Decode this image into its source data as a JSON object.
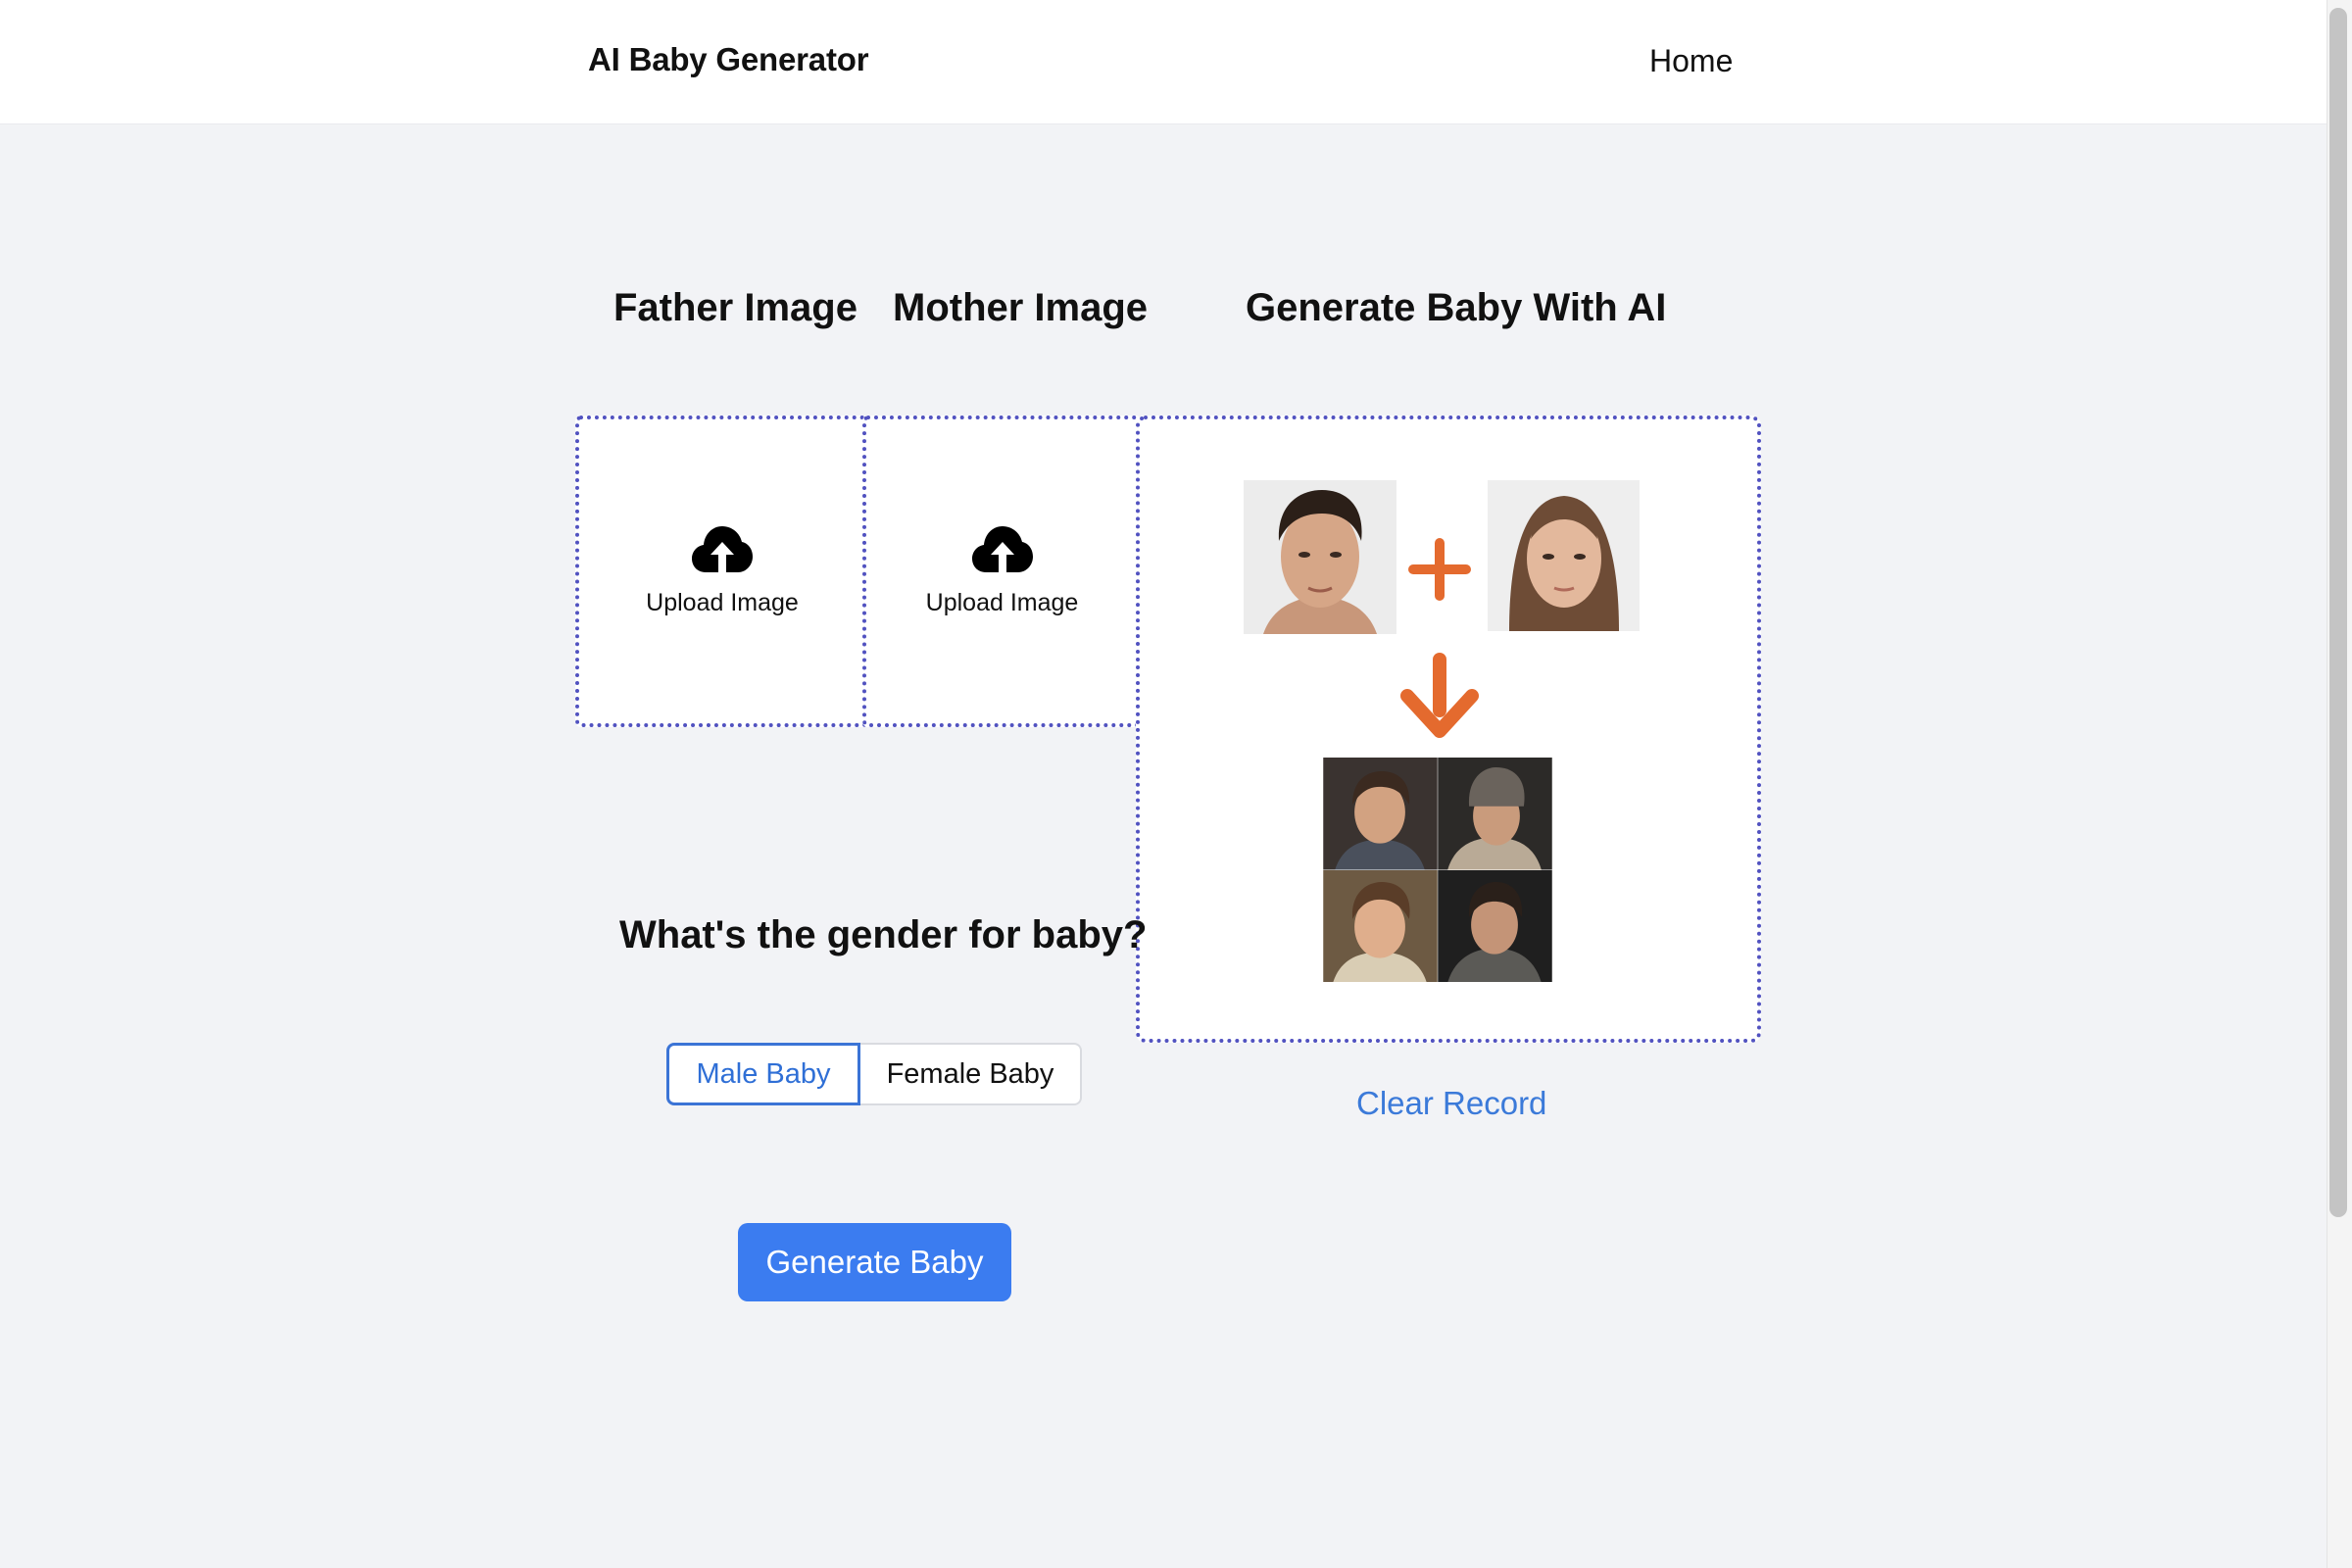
{
  "header": {
    "brand": "AI Baby Generator",
    "nav_home": "Home"
  },
  "sections": {
    "father_title": "Father Image",
    "mother_title": "Mother Image",
    "generate_title": "Generate Baby With AI"
  },
  "upload": {
    "father_label": "Upload Image",
    "mother_label": "Upload Image",
    "icon": "cloud-upload-icon"
  },
  "preview": {
    "plus_icon": "plus-icon",
    "arrow_icon": "arrow-down-icon",
    "accent_color": "#e46a2e"
  },
  "gender": {
    "question": "What's the gender for baby?",
    "options": [
      "Male Baby",
      "Female Baby"
    ],
    "selected": "Male Baby"
  },
  "actions": {
    "generate": "Generate Baby",
    "clear": "Clear Record"
  },
  "colors": {
    "primary": "#3b7cf0",
    "link": "#3b7ad9",
    "dotted_border": "#5152c0",
    "background": "#f2f3f6"
  }
}
